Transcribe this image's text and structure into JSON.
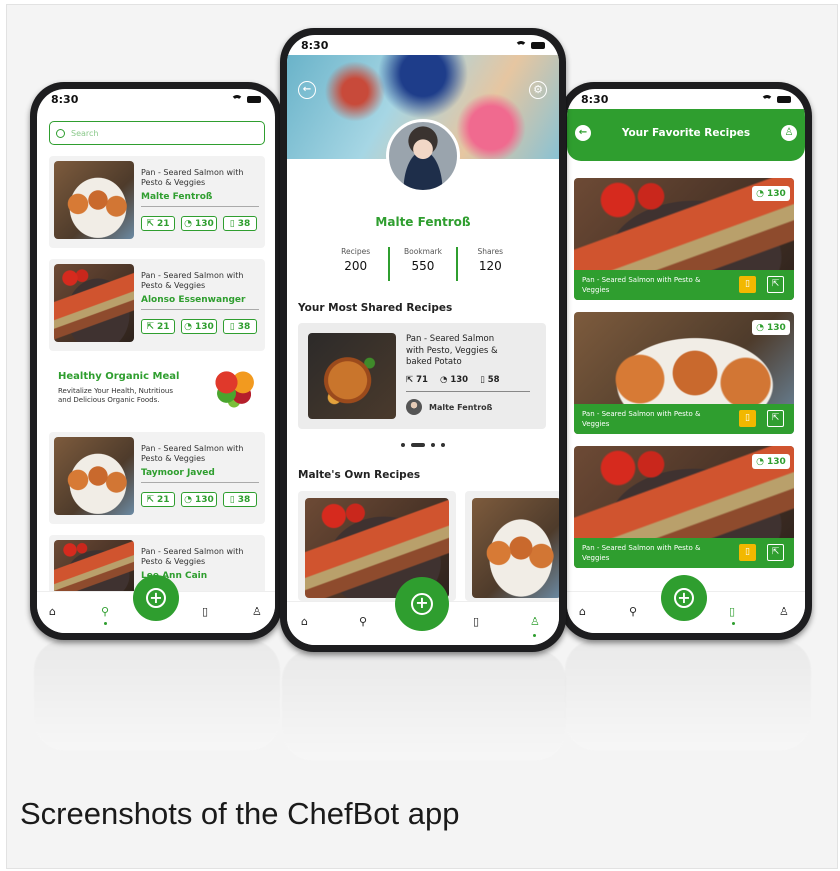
{
  "status_time": "8:30",
  "left": {
    "search_placeholder": "Search",
    "recipes": [
      {
        "title": "Pan - Seared Salmon with Pesto & Veggies",
        "author": "Malte Fentroß",
        "shares": "21",
        "time": "130",
        "bookmarks": "38"
      },
      {
        "title": "Pan - Seared Salmon with Pesto & Veggies",
        "author": "Alonso Essenwanger",
        "shares": "21",
        "time": "130",
        "bookmarks": "38"
      },
      {
        "title": "Pan - Seared Salmon with Pesto & Veggies",
        "author": "Taymoor Javed",
        "shares": "21",
        "time": "130",
        "bookmarks": "38"
      },
      {
        "title": "Pan - Seared Salmon with Pesto & Veggies",
        "author": "Lee Ann Cain"
      }
    ],
    "promo": {
      "title": "Healthy Organic Meal",
      "text": "Revitalize Your Health, Nutritious and Delicious Organic Foods."
    }
  },
  "center": {
    "name": "Malte Fentroß",
    "stats": [
      {
        "label": "Recipes",
        "value": "200"
      },
      {
        "label": "Bookmark",
        "value": "550"
      },
      {
        "label": "Shares",
        "value": "120"
      }
    ],
    "shared_heading": "Your Most Shared Recipes",
    "shared_card": {
      "title": "Pan - Seared Salmon with Pesto, Veggies & baked Potato",
      "shares": "71",
      "time": "130",
      "bookmarks": "58",
      "author": "Malte Fentroß"
    },
    "own_heading": "Malte's Own Recipes"
  },
  "right": {
    "title": "Your Favorite Recipes",
    "cards": [
      {
        "title": "Pan - Seared Salmon with Pesto & Veggies",
        "time": "130"
      },
      {
        "title": "Pan - Seared Salmon with Pesto & Veggies",
        "time": "130"
      },
      {
        "title": "Pan - Seared Salmon with Pesto & Veggies",
        "time": "130"
      }
    ]
  },
  "caption": "Screenshots of the ChefBot app",
  "colors": {
    "accent": "#2f9e2f",
    "bookmark_badge": "#f2b800"
  }
}
